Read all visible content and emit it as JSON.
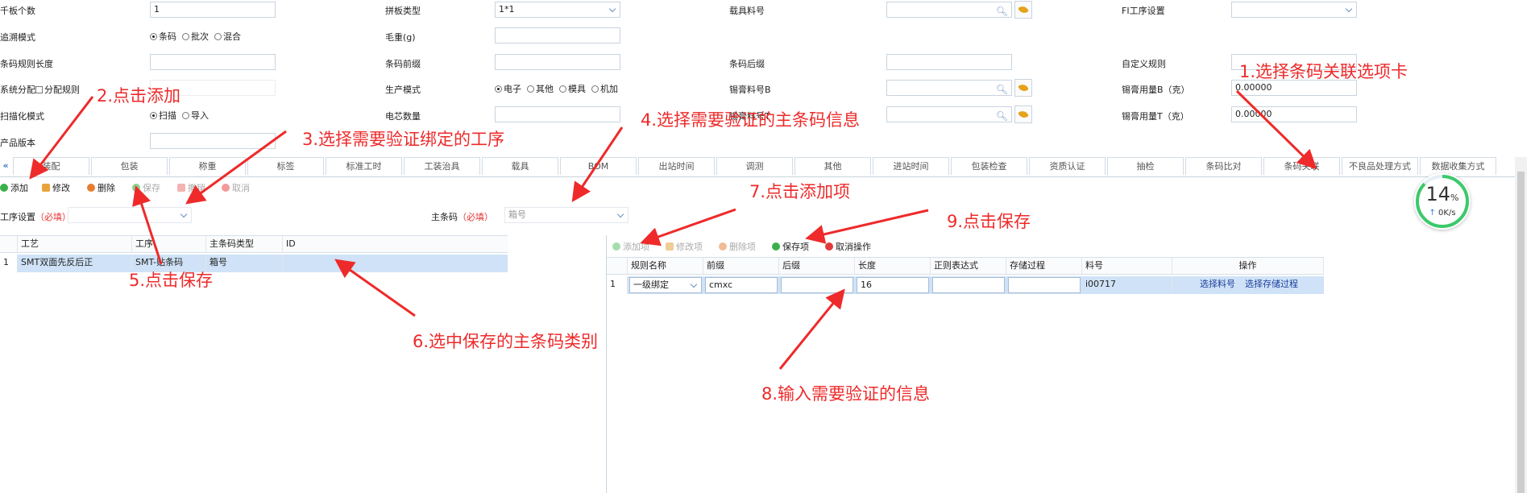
{
  "form": {
    "r1": {
      "l1": "千板个数",
      "v1": "1",
      "l2": "拼板类型",
      "v2": "1*1",
      "l3": "载具料号",
      "l4": "FI工序设置"
    },
    "r2": {
      "l1": "追溯模式",
      "o1": "条码",
      "o2": "批次",
      "o3": "混合",
      "l2": "毛重(g)"
    },
    "r3": {
      "l1": "条码规则长度",
      "l2": "条码前缀",
      "l3": "条码后缀",
      "l4": "自定义规则"
    },
    "r4": {
      "l1": "系统分配",
      "chk": "分配规则",
      "l2": "生产模式",
      "o1": "电子",
      "o2": "其他",
      "o3": "模具",
      "o4": "机加",
      "l3": "锡膏料号B",
      "l4": "锡膏用量B（克）",
      "v4": "0.00000"
    },
    "r5": {
      "l1": "扫描化模式",
      "o1": "扫描",
      "o2": "导入",
      "l2": "电芯数量",
      "l3": "锡膏料号T",
      "l4": "锡膏用量T（克）",
      "v4": "0.00000"
    },
    "r6": {
      "l1": "产品版本"
    }
  },
  "tabs": [
    "装配",
    "包装",
    "称重",
    "标签",
    "标准工时",
    "工装治具",
    "载具",
    "BOM",
    "出站时间",
    "调测",
    "其他",
    "进站时间",
    "包装检查",
    "资质认证",
    "抽检",
    "条码比对",
    "条码关联",
    "不良品处理方式",
    "数据收集方式"
  ],
  "tab_collapse": "«",
  "toolbar": {
    "add": "添加",
    "edit": "修改",
    "del": "删除",
    "save": "保存",
    "undo": "撤销",
    "cancel": "取消"
  },
  "filter": {
    "proc_label": "工序设置",
    "req": "（必填）",
    "main_label": "主条码",
    "main_value": "箱号"
  },
  "left_grid": {
    "headers": [
      "工艺",
      "工序",
      "主条码类型",
      "ID"
    ],
    "rows": [
      {
        "idx": "1",
        "c1": "SMT双面先反后正",
        "c2": "SMT-贴条码",
        "c3": "箱号",
        "c4": ""
      }
    ]
  },
  "right_toolbar": {
    "add": "添加项",
    "edit": "修改项",
    "del": "删除项",
    "save": "保存项",
    "cancel": "取消操作"
  },
  "right_grid": {
    "headers": [
      "规则名称",
      "前缀",
      "后缀",
      "长度",
      "正则表达式",
      "存储过程",
      "料号",
      "操作"
    ],
    "rows": [
      {
        "idx": "1",
        "rule": "一级绑定",
        "prefix": "cmxc",
        "suffix": "",
        "length": "16",
        "regex": "",
        "proc": "",
        "part": "i00717",
        "op1": "选择料号",
        "op2": "选择存储过程"
      }
    ]
  },
  "speed": {
    "pct": "14",
    "unit": "%",
    "rate": "0K/s"
  },
  "annotations": {
    "a1": "1.选择条码关联选项卡",
    "a2": "2.点击添加",
    "a3": "3.选择需要验证绑定的工序",
    "a4": "4.选择需要验证的主条码信息",
    "a5": "5.点击保存",
    "a6": "6.选中保存的主条码类别",
    "a7": "7.点击添加项",
    "a8": "8.输入需要验证的信息",
    "a9": "9.点击保存"
  },
  "colors": {
    "annotation": "#ee2a2a",
    "selected_row": "#cfe2f7",
    "tab_border": "#d2dbe5"
  }
}
